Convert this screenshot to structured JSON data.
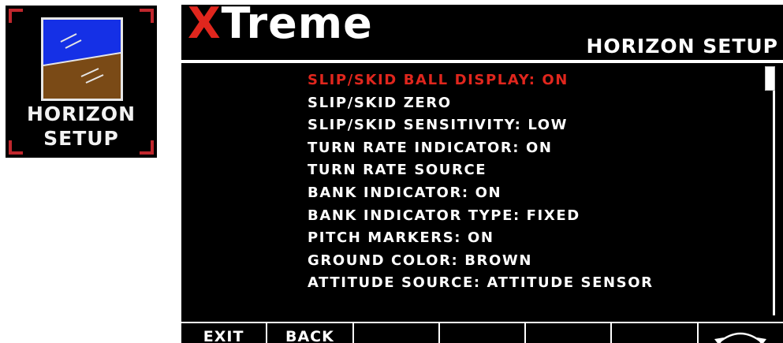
{
  "icon_tile": {
    "label_line1": "HORIZON",
    "label_line2": "SETUP",
    "icon": "horizon-setup-icon",
    "sky_color": "#1530e6",
    "ground_color": "#7a4a16",
    "corner_color": "#c0272d"
  },
  "screen": {
    "brand_first": "X",
    "brand_rest": "Treme",
    "title": "HORIZON SETUP",
    "accent_color": "#e0261d",
    "menu_items": [
      "SLIP/SKID BALL DISPLAY: ON",
      "SLIP/SKID ZERO",
      "SLIP/SKID SENSITIVITY: LOW",
      "TURN RATE INDICATOR: ON",
      "TURN RATE SOURCE",
      "BANK INDICATOR: ON",
      "BANK INDICATOR TYPE: FIXED",
      "PITCH MARKERS: ON",
      "GROUND COLOR: BROWN",
      "ATTITUDE SOURCE: ATTITUDE SENSOR"
    ],
    "selected_index": 0,
    "softkeys": [
      "EXIT",
      "BACK",
      "",
      "",
      "",
      "",
      ""
    ],
    "rotary_icon": "rotary-knob-icon"
  }
}
